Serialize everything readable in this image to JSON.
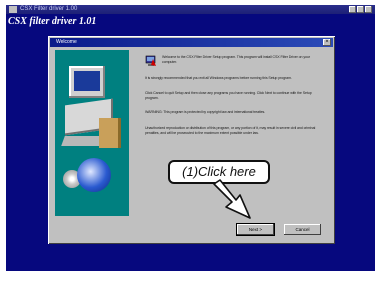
{
  "window": {
    "title": "CSX Filter driver 1.00",
    "heading": "CSX filter driver 1.01"
  },
  "dialog": {
    "title": "Welcome",
    "close": "×",
    "paragraphs": [
      "Welcome to the CSX Filter Driver Setup program. This program will install CSX Filter Driver on your computer.",
      "It is strongly recommended that you exit all Windows programs before running this Setup program.",
      "Click Cancel to quit Setup and then close any programs you have running. Click Next to continue with the Setup program.",
      "WARNING: This program is protected by copyright law and international treaties.",
      "Unauthorized reproduction or distribution of this program, or any portion of it, may result in severe civil and criminal penalties, and will be prosecuted to the maximum extent possible under law."
    ],
    "buttons": {
      "next": "Next >",
      "cancel": "Cancel"
    }
  },
  "annotation": {
    "callout": "(1)Click here"
  },
  "colors": {
    "desktop": "#06087e",
    "dialog": "#c0c0c0",
    "graphic": "#008080"
  }
}
